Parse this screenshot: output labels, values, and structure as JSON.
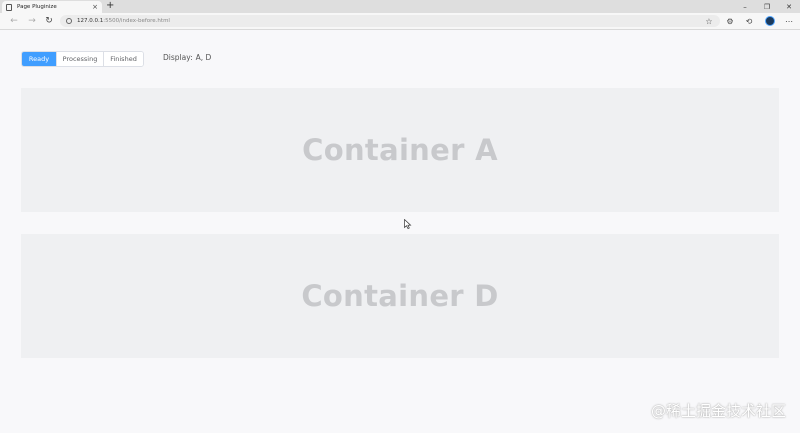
{
  "browser": {
    "tab_title": "Page Pluginize",
    "tab_close": "×",
    "new_tab": "+",
    "window": {
      "minimize": "–",
      "restore": "❐",
      "close": "✕"
    },
    "nav": {
      "back": "←",
      "forward": "→",
      "reload": "↻"
    },
    "url_host": "127.0.0.1",
    "url_rest": ":5500/index-before.html",
    "toolbar": {
      "favorites": "☆",
      "extensions": "⚙",
      "collections": "⟲",
      "menu": "⋯"
    }
  },
  "status_tabs": [
    {
      "label": "Ready",
      "active": true
    },
    {
      "label": "Processing",
      "active": false
    },
    {
      "label": "Finished",
      "active": false
    }
  ],
  "display": {
    "label": "Display:",
    "value": "A, D"
  },
  "containers": [
    {
      "label": "Container A"
    },
    {
      "label": "Container D"
    }
  ],
  "watermark": "@稀土掘金技术社区",
  "colors": {
    "accent": "#409eff",
    "container_bg": "#eff0f2",
    "container_text": "#c8c9cc"
  }
}
